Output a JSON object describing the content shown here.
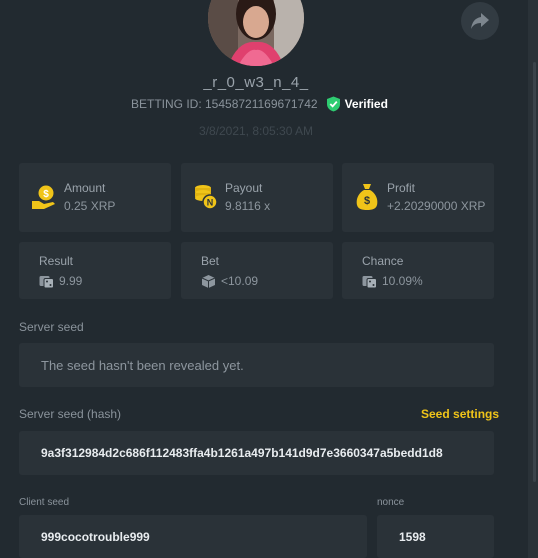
{
  "profile": {
    "username": "_r_0_w3_n_4_",
    "betting_id_label": "BETTING ID: 15458721169671742",
    "verified_label": "Verified",
    "timestamp": "3/8/2021, 8:05:30 AM"
  },
  "stats": {
    "amount": {
      "label": "Amount",
      "value": "0.25 XRP"
    },
    "payout": {
      "label": "Payout",
      "value": "9.8116 x"
    },
    "profit": {
      "label": "Profit",
      "value": "+2.20290000 XRP"
    },
    "result": {
      "label": "Result",
      "value": "9.99"
    },
    "bet": {
      "label": "Bet",
      "value": "<10.09"
    },
    "chance": {
      "label": "Chance",
      "value": "10.09%"
    }
  },
  "server_seed": {
    "label": "Server seed",
    "value": "The seed hasn't been revealed yet."
  },
  "server_seed_hash": {
    "label": "Server seed (hash)",
    "settings_link": "Seed settings",
    "value": "9a3f312984d2c686f112483ffa4b1261a497b141d9d7e3660347a5bedd1d8"
  },
  "client_seed": {
    "label": "Client seed",
    "value": "999cocotrouble999"
  },
  "nonce": {
    "label": "nonce",
    "value": "1598"
  },
  "colors": {
    "background": "#222a30",
    "card": "#2a3238",
    "accent_yellow": "#f0c419",
    "verified_green": "#2ecc71"
  },
  "icons": [
    "share-icon",
    "verified-shield-icon",
    "money-hand-icon",
    "coin-stack-icon",
    "money-bag-icon",
    "dice-icon"
  ]
}
